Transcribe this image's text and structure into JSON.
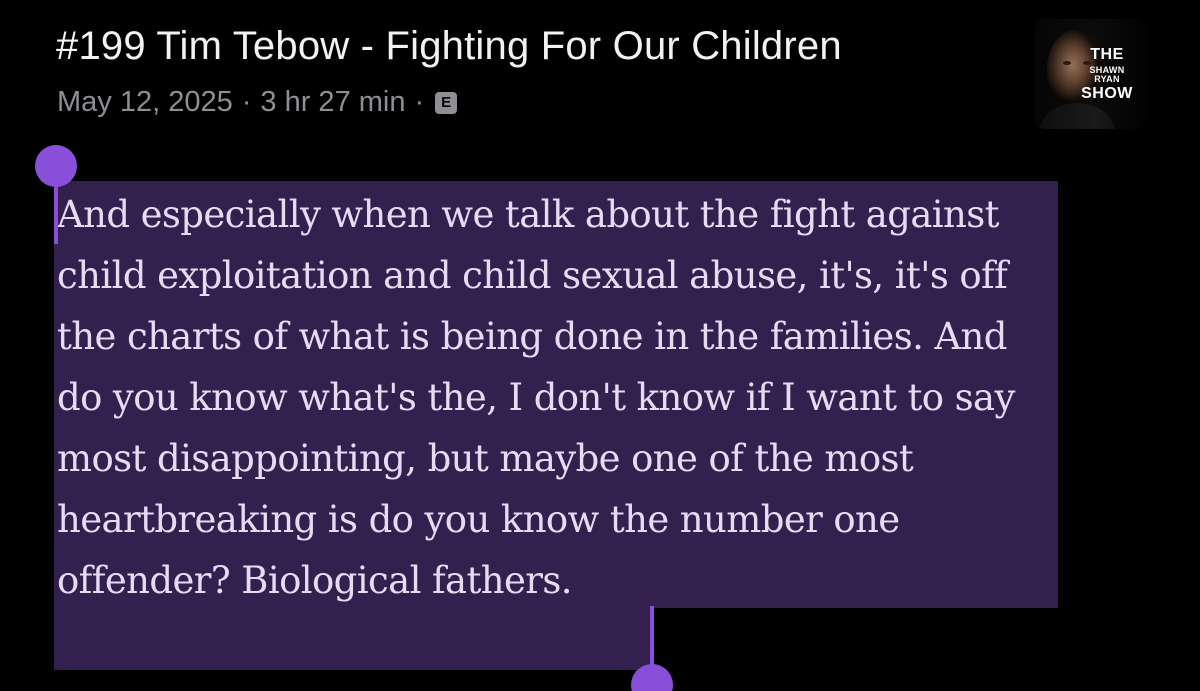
{
  "episode": {
    "title": "#199 Tim Tebow - Fighting For Our Children",
    "date": "May 12, 2025",
    "duration": "3 hr 27 min",
    "separator": "·",
    "explicit_badge": "E"
  },
  "artwork": {
    "line1": "THE",
    "line2": "SHAWN RYAN",
    "line3": "SHOW"
  },
  "transcript": {
    "selected_text": "And especially when we talk about the fight against child exploitation and child sexual abuse, it's, it's off the charts of what is being done in the families. And do you know what's the, I don't know if I want to say most disappointing, but maybe one of the most heartbreaking is do you know the number one offender? Biological fathers."
  },
  "colors": {
    "background": "#000000",
    "selection_highlight": "#33204f",
    "selection_handle": "#8a4fd8",
    "transcript_text": "#e5dcf2",
    "title_text": "#f2f2f2",
    "meta_text": "#8e8e93"
  },
  "icons": {
    "explicit": "explicit-badge-icon",
    "selection_start": "selection-handle-start-icon",
    "selection_end": "selection-handle-end-icon"
  }
}
